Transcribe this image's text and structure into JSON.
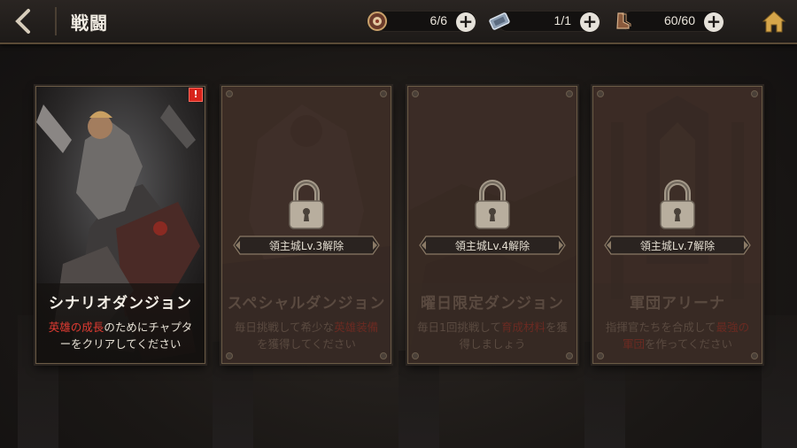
{
  "header": {
    "title": "戦闘"
  },
  "resources": [
    {
      "icon": "medal-coin-icon",
      "value": "6/6"
    },
    {
      "icon": "ticket-icon",
      "value": "1/1"
    },
    {
      "icon": "boots-icon",
      "value": "60/60"
    }
  ],
  "cards": [
    {
      "name": "シナリオダンジョン",
      "desc_highlight": "英雄の成長",
      "desc_rest": "のためにチャプターをクリアしてください",
      "locked": false,
      "alert": "!"
    },
    {
      "name": "スペシャルダンジョン",
      "desc_pre": "毎日挑戦して希少な",
      "desc_highlight": "英雄装備",
      "desc_rest": "を獲得してください",
      "locked": true,
      "unlock_text": "領主城Lv.3解除"
    },
    {
      "name": "曜日限定ダンジョン",
      "desc_pre": "毎日1回挑戦して",
      "desc_highlight": "育成材料",
      "desc_rest": "を獲得しましょう",
      "locked": true,
      "unlock_text": "領主城Lv.4解除"
    },
    {
      "name": "軍団アリーナ",
      "desc_pre": "指揮官たちを合成して",
      "desc_highlight": "最強の軍団",
      "desc_rest": "を作ってください",
      "locked": true,
      "unlock_text": "領主城Lv.7解除"
    }
  ],
  "colors": {
    "accent_red": "#e03b32",
    "frame_gold": "#6b5b46"
  }
}
